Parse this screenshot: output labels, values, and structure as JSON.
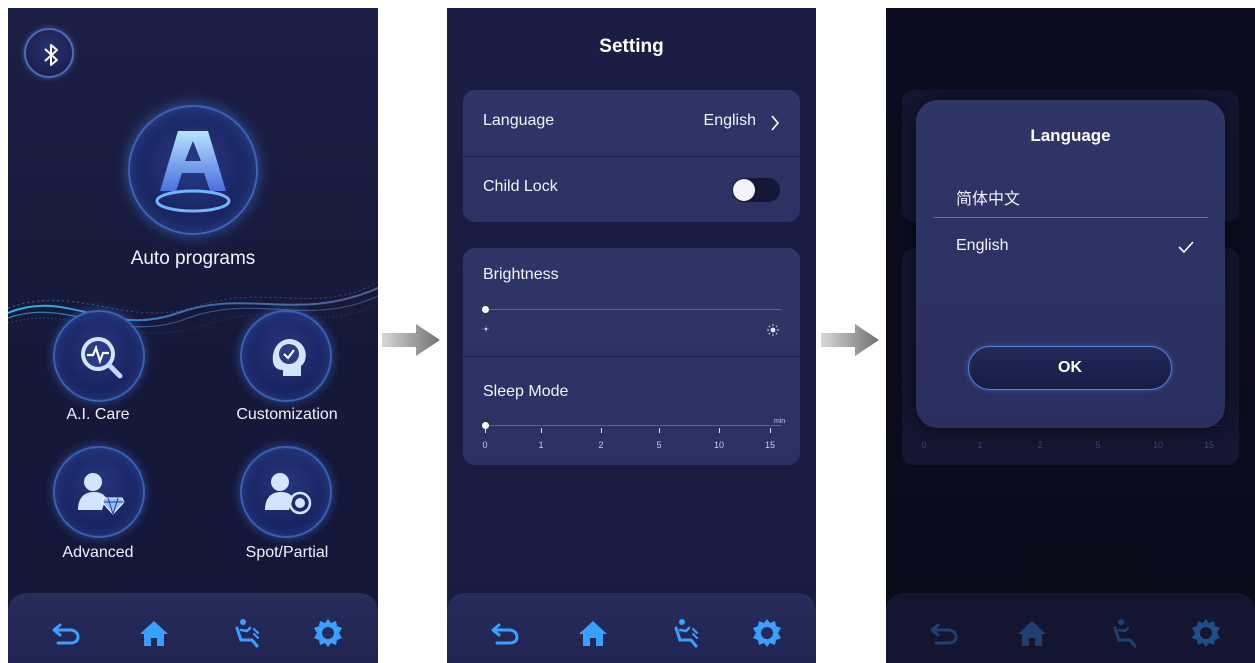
{
  "screens": {
    "home": {
      "auto_programs_label": "Auto programs",
      "features": [
        {
          "label": "A.I. Care"
        },
        {
          "label": "Customization"
        },
        {
          "label": "Advanced"
        },
        {
          "label": "Spot/Partial"
        }
      ]
    },
    "settings": {
      "title": "Setting",
      "language_label": "Language",
      "language_value": "English",
      "child_lock_label": "Child Lock",
      "child_lock_on": false,
      "brightness_label": "Brightness",
      "brightness_level": 0,
      "sleep_mode_label": "Sleep Mode",
      "sleep_ticks": [
        "0",
        "1",
        "2",
        "5",
        "10",
        "15"
      ],
      "sleep_unit": "min",
      "sleep_value": "0"
    },
    "language_dialog": {
      "title": "Language",
      "options": [
        "简体中文",
        "English"
      ],
      "selected": "English",
      "ok_label": "OK",
      "bg_ticks": [
        "0",
        "1",
        "2",
        "5",
        "10",
        "15"
      ]
    }
  },
  "nav": [
    "back-icon",
    "home-icon",
    "massage-icon",
    "settings-icon"
  ],
  "colors": {
    "accent": "#3aa0ff",
    "panel": "#2f3567",
    "background": "#1a1d42"
  }
}
